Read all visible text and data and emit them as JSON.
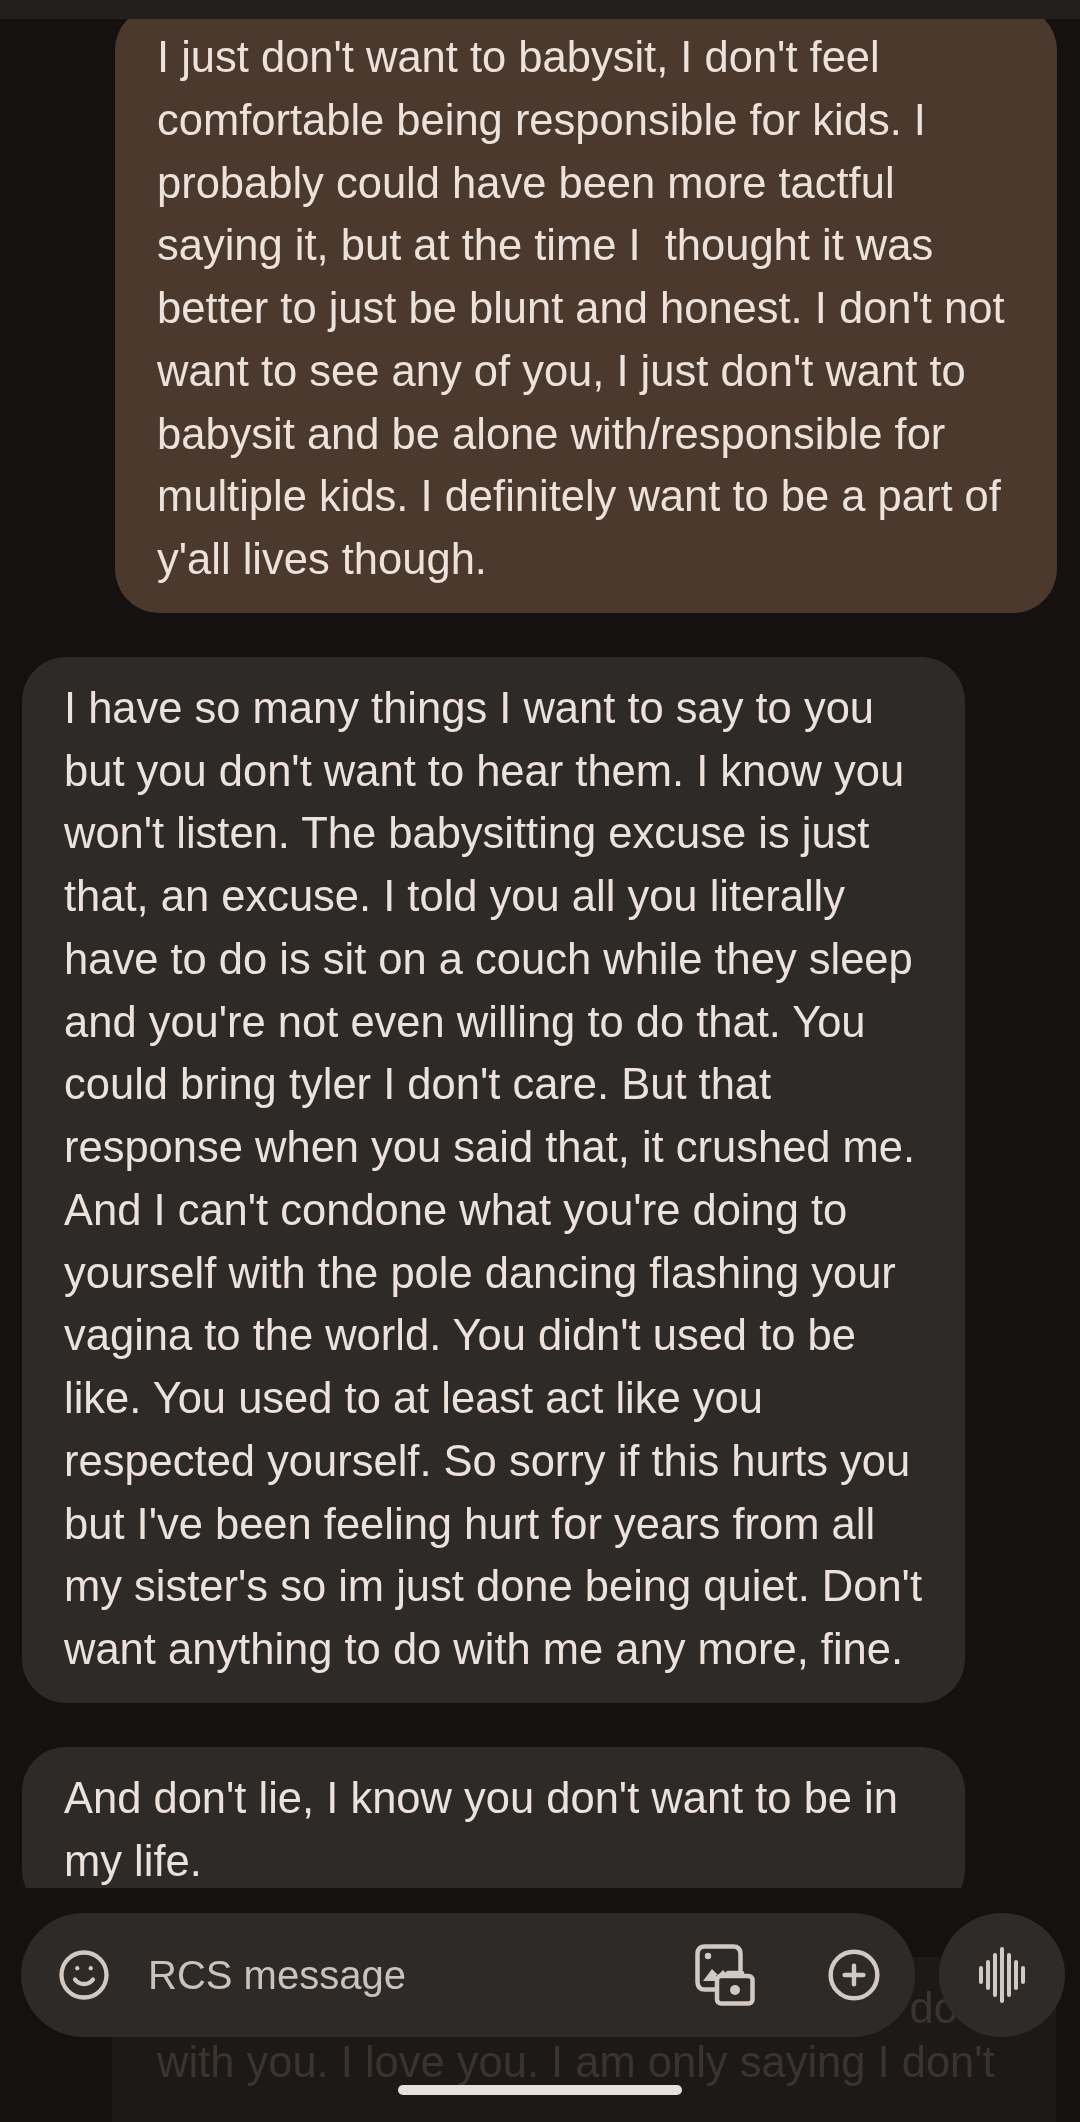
{
  "messages": [
    {
      "kind": "sent",
      "text": "I just don't want to babysit, I don't feel\ncomfortable being responsible for kids. I\nprobably could have been more tactful\nsaying it, but at the time I  thought it was\nbetter to just be blunt and honest. I don't not\nwant to see any of you, I just don't want to\nbabysit and be alone with/responsible for\nmultiple kids. I definitely want to be a part of\ny'all lives though."
    },
    {
      "kind": "received",
      "text": "I have so many things I want to say to you\nbut you don't want to hear them. I know you\nwon't listen. The babysitting excuse is just\nthat, an excuse. I told you all you literally\nhave to do is sit on a couch while they sleep\nand you're not even willing to do that. You\ncould bring tyler I don't care. But that\nresponse when you said that, it crushed me.\nAnd I can't condone what you're doing to\nyourself with the pole dancing flashing your\nvagina to the world. You didn't used to be\nlike. You used to at least act like you\nrespected yourself. So sorry if this hurts you\nbut I've been feeling hurt for years from all\nmy sister's so im just done being quiet. Don't\nwant anything to do with me any more, fine."
    },
    {
      "kind": "received",
      "text": "And don't lie, I know you don't want to be in\nmy life."
    }
  ],
  "message_behind_composer": {
    "kind": "sent",
    "visible_line_tail": "do",
    "lines": [
      "with you. I love you. I am only saying I don't"
    ]
  },
  "composer": {
    "placeholder": "RCS message"
  }
}
